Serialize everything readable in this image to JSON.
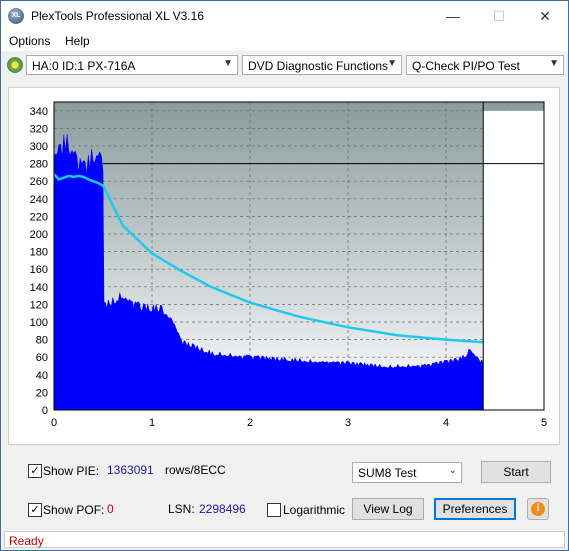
{
  "window": {
    "title": "PlexTools Professional XL V3.16",
    "icon_text": "XL",
    "controls": {
      "minimize": "—",
      "maximize": "☐",
      "close": "✕"
    }
  },
  "menu": [
    "Options",
    "Help"
  ],
  "toolbar": {
    "drive": "HA:0 ID:1  PX-716A",
    "function": "DVD Diagnostic Functions",
    "test": "Q-Check PI/PO Test"
  },
  "chart_data": {
    "type": "area",
    "xlabel": "",
    "ylabel": "",
    "xlim": [
      0,
      5
    ],
    "ylim": [
      0,
      350
    ],
    "x_ticks": [
      0,
      1,
      2,
      3,
      4,
      5
    ],
    "y_ticks": [
      0,
      20,
      40,
      60,
      80,
      100,
      120,
      140,
      160,
      180,
      200,
      220,
      240,
      260,
      280,
      300,
      320,
      340
    ],
    "grid": true,
    "data_end_x": 4.38,
    "marker_level": 280,
    "series": [
      {
        "color": "#0000ff",
        "x": [
          0.0,
          0.05,
          0.1,
          0.15,
          0.2,
          0.25,
          0.3,
          0.35,
          0.4,
          0.45,
          0.5,
          0.51,
          0.6,
          0.7,
          0.8,
          0.9,
          1.0,
          1.1,
          1.2,
          1.3,
          1.4,
          1.6,
          1.8,
          2.0,
          2.2,
          2.4,
          2.6,
          2.8,
          3.0,
          3.2,
          3.4,
          3.6,
          3.8,
          4.0,
          4.1,
          4.2,
          4.25,
          4.3,
          4.38
        ],
        "values": [
          290,
          300,
          310,
          305,
          300,
          290,
          280,
          285,
          290,
          295,
          290,
          120,
          125,
          130,
          125,
          120,
          118,
          115,
          105,
          80,
          75,
          65,
          62,
          62,
          60,
          58,
          56,
          55,
          55,
          52,
          50,
          50,
          52,
          56,
          58,
          62,
          70,
          62,
          55
        ]
      },
      {
        "color": "#1ec8f0",
        "x": [
          0.0,
          0.05,
          0.1,
          0.15,
          0.2,
          0.25,
          0.3,
          0.35,
          0.4,
          0.45,
          0.5,
          0.7,
          1.0,
          1.3,
          1.6,
          2.0,
          2.5,
          3.0,
          3.5,
          4.0,
          4.38
        ],
        "values": [
          268,
          262,
          264,
          266,
          265,
          266,
          265,
          262,
          260,
          258,
          255,
          210,
          178,
          158,
          140,
          122,
          106,
          94,
          85,
          80,
          77
        ]
      }
    ]
  },
  "bottom": {
    "show_pie_label": "Show PIE:",
    "pie_value": "1363091",
    "rows_label": "rows/8ECC",
    "show_pof_label": "Show POF:",
    "pof_value": "0",
    "lsn_label": "LSN:",
    "lsn_value": "2298496",
    "log_label": "Logarithmic",
    "sum_select": "SUM8 Test",
    "start_label": "Start",
    "viewlog_label": "View Log",
    "prefs_label": "Preferences",
    "info_icon_text": "i"
  },
  "status": {
    "text": "Ready",
    "color": "#cc0000"
  }
}
